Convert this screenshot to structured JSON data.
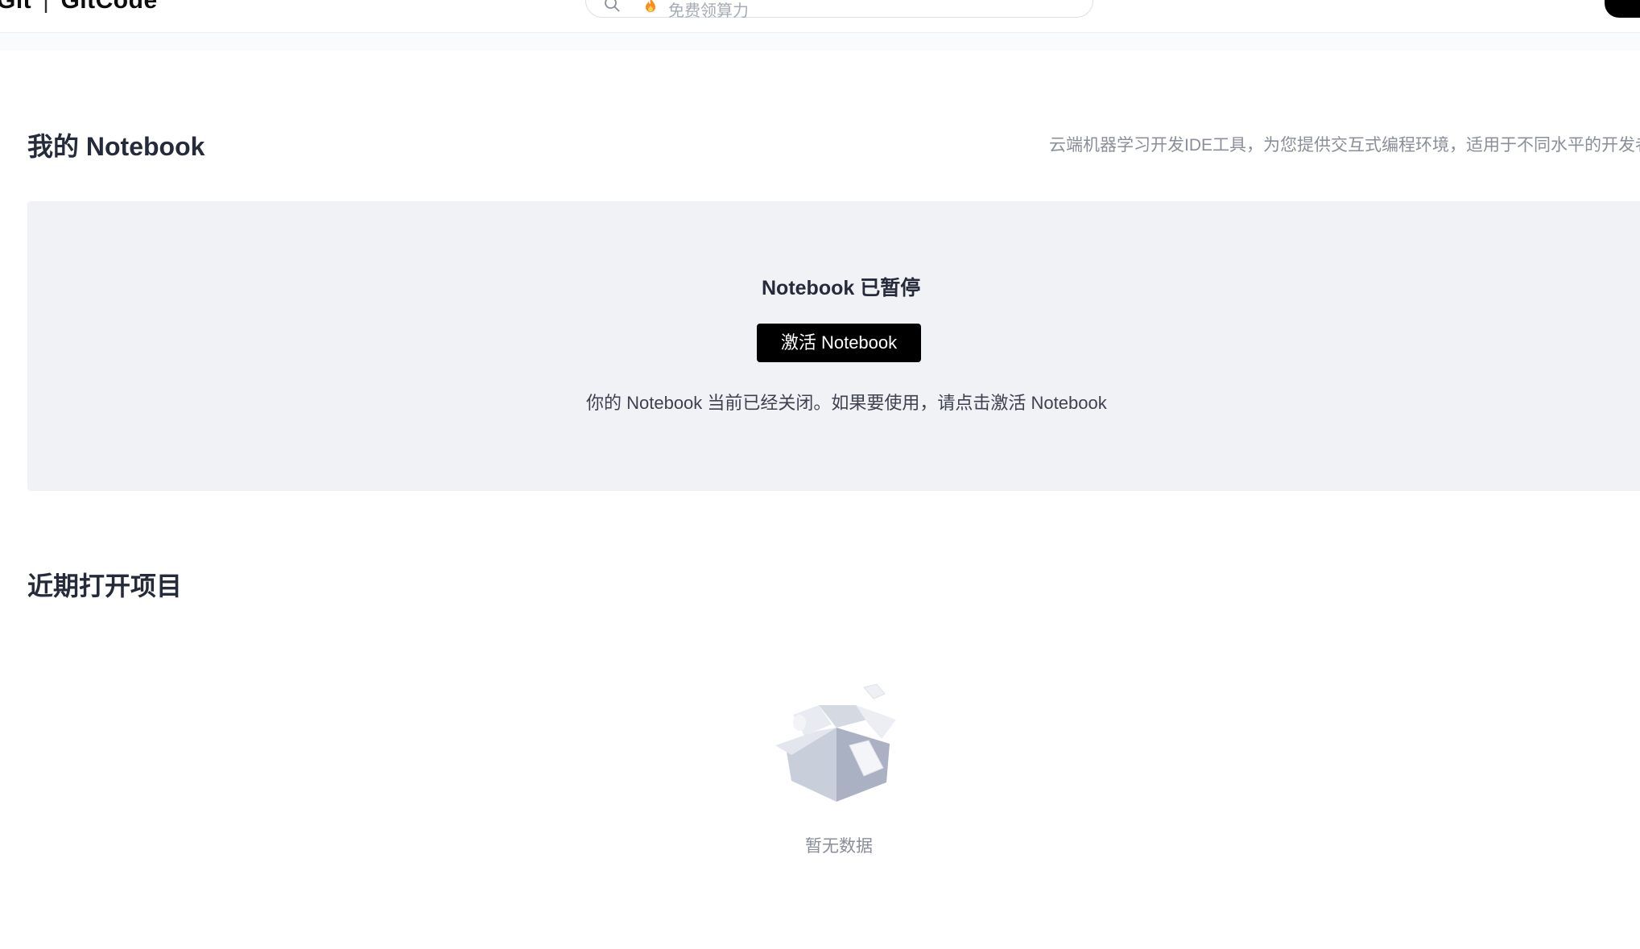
{
  "header": {
    "logo_left": "Git",
    "logo_separator": "|",
    "logo_right": "GitCode",
    "search_placeholder": "免费领算力"
  },
  "notebook": {
    "title": "我的 Notebook",
    "description": "云端机器学习开发IDE工具，为您提供交互式编程环境，适用于不同水平的开发者",
    "paused_title": "Notebook 已暂停",
    "activate_button": "激活 Notebook",
    "paused_hint": "你的 Notebook 当前已经关闭。如果要使用，请点击激活 Notebook"
  },
  "recent": {
    "title": "近期打开项目",
    "empty_text": "暂无数据"
  },
  "icons": {
    "search": "search-icon",
    "flame": "flame-icon",
    "empty_box": "empty-box-icon"
  },
  "colors": {
    "panel_bg": "#f1f2f6",
    "primary_button": "#000000",
    "muted_text": "#8a8e99",
    "title_text": "#252b3a"
  }
}
